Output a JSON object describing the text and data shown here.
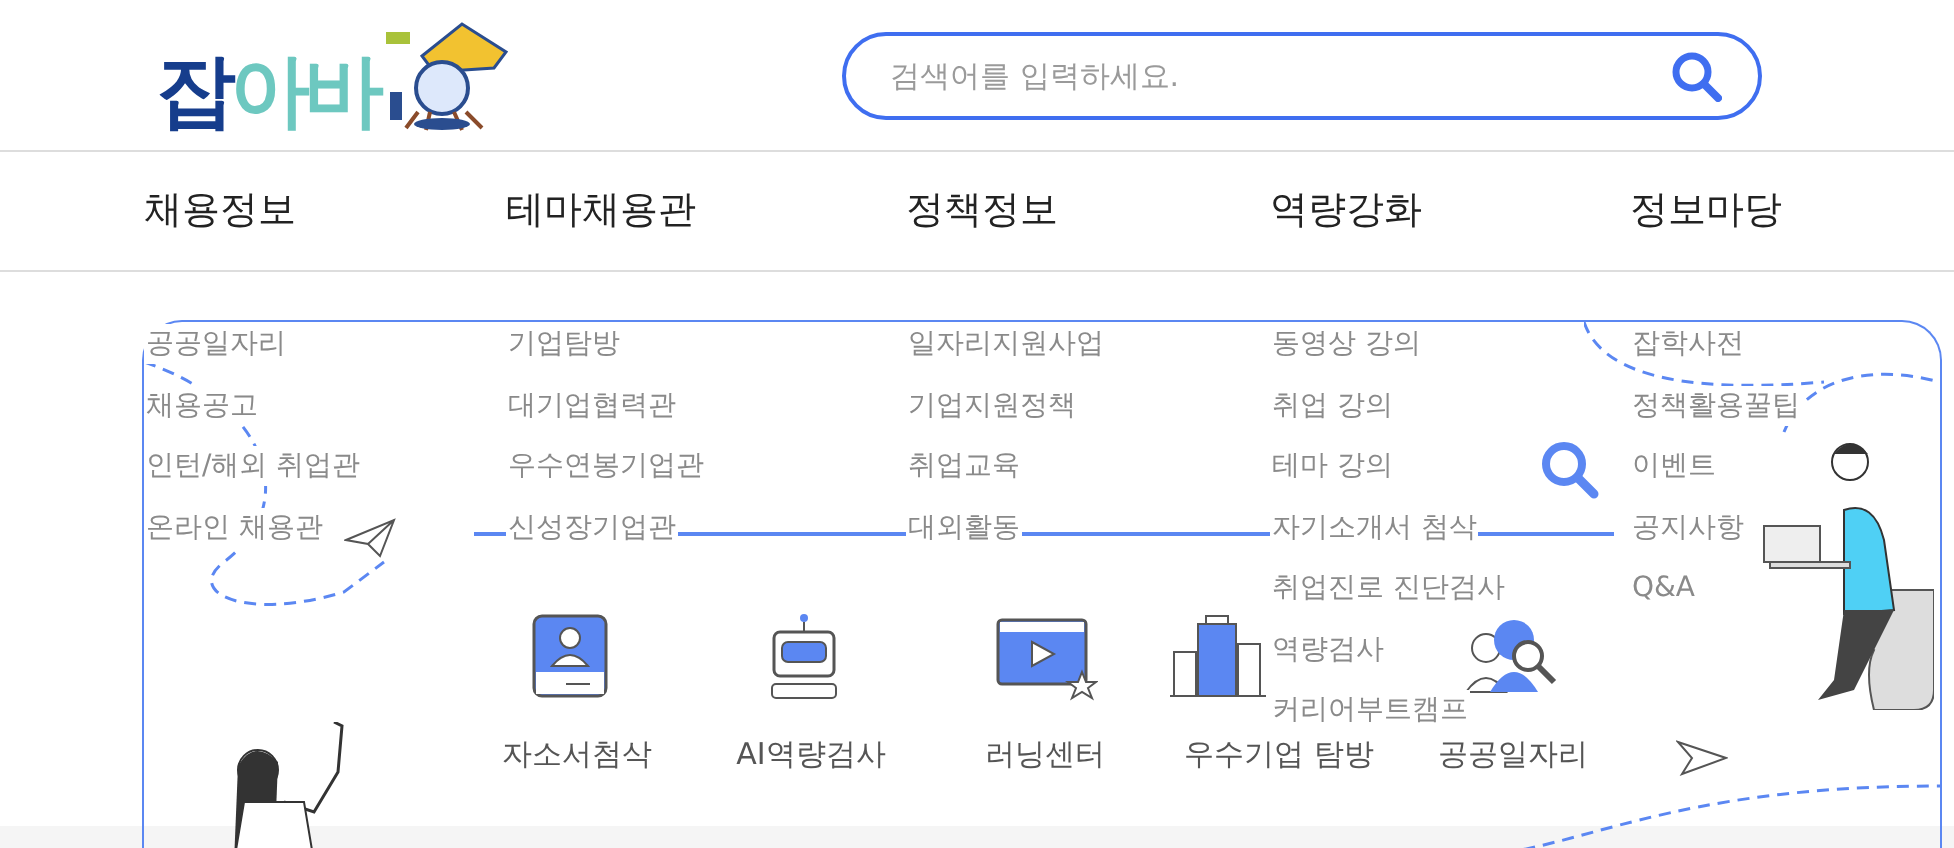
{
  "logo": {
    "parts": [
      {
        "text": "잡",
        "color": "#163d8c"
      },
      {
        "text": "아바",
        "color": "#6dc8c0"
      }
    ]
  },
  "search": {
    "placeholder": "검색어를 입력하세요."
  },
  "nav": [
    {
      "label": "채용정보",
      "submenu": [
        "공공일자리",
        "채용공고",
        "인턴/해외 취업관",
        "온라인 채용관"
      ]
    },
    {
      "label": "테마채용관",
      "submenu": [
        "기업탐방",
        "대기업협력관",
        "우수연봉기업관",
        "신성장기업관"
      ]
    },
    {
      "label": "정책정보",
      "submenu": [
        "일자리지원사업",
        "기업지원정책",
        "취업교육",
        "대외활동"
      ]
    },
    {
      "label": "역량강화",
      "submenu": [
        "동영상 강의",
        "취업 강의",
        "테마 강의",
        "자기소개서 첨삭",
        "취업진로 진단검사",
        "역량검사",
        "커리어부트캠프"
      ]
    },
    {
      "label": "정보마당",
      "submenu": [
        "잡학사전",
        "정책활용꿀팁",
        "이벤트",
        "공지사항",
        "Q&A"
      ]
    }
  ],
  "quick_links": [
    {
      "label": "자소서첨삭",
      "kind": "resume"
    },
    {
      "label": "AI역량검사",
      "kind": "robot"
    },
    {
      "label": "러닝센터",
      "kind": "video"
    },
    {
      "label": "우수기업 탐방",
      "kind": "building"
    },
    {
      "label": "공공일자리",
      "kind": "people"
    }
  ]
}
